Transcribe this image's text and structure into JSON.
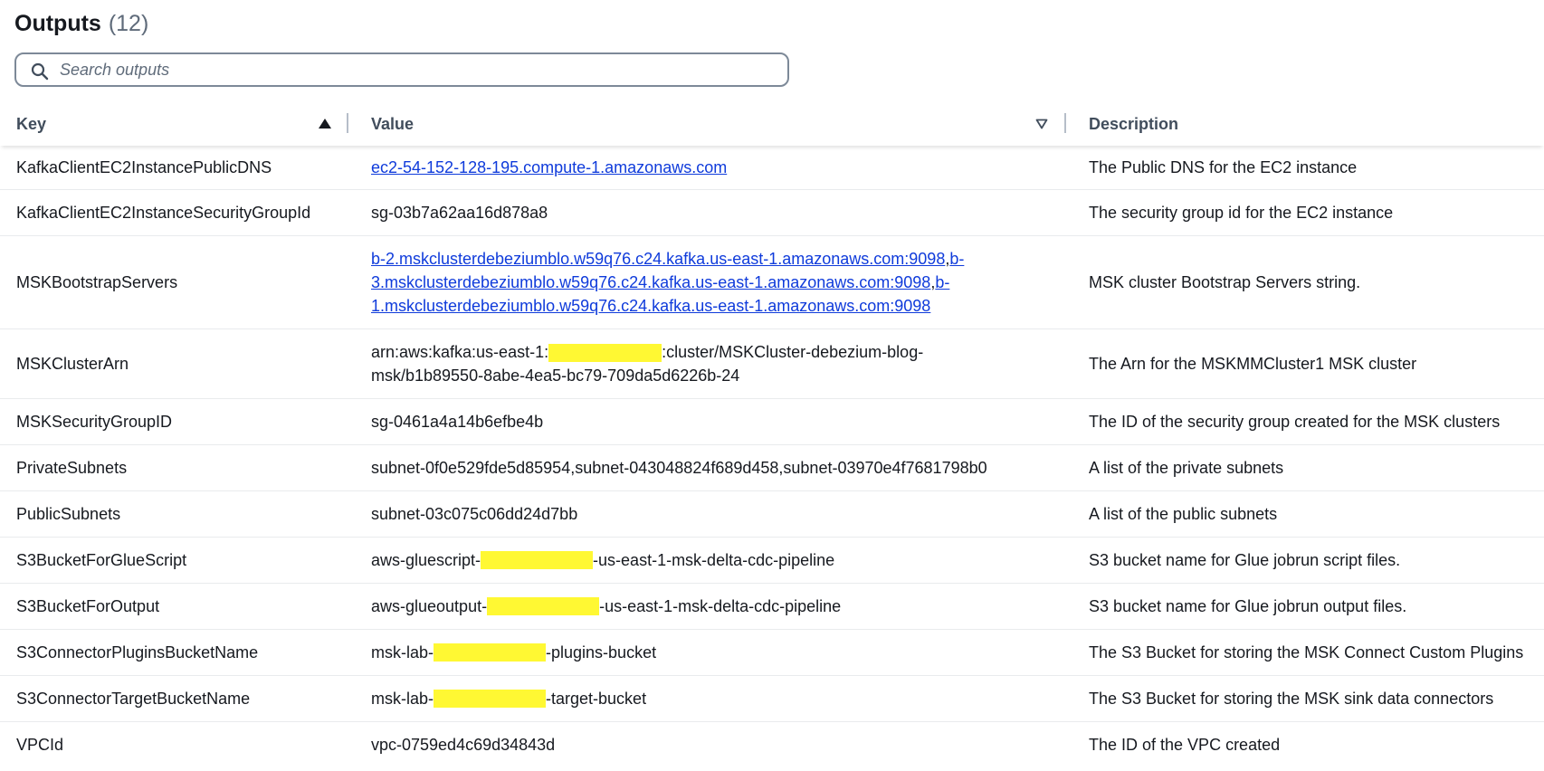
{
  "header": {
    "title": "Outputs",
    "count": "(12)"
  },
  "search": {
    "placeholder": "Search outputs"
  },
  "columns": {
    "key": "Key",
    "value": "Value",
    "description": "Description"
  },
  "rows": [
    {
      "key": "KafkaClientEC2InstancePublicDNS",
      "value": "ec2-54-152-128-195.compute-1.amazonaws.com",
      "description": "The Public DNS for the EC2 instance"
    },
    {
      "key": "KafkaClientEC2InstanceSecurityGroupId",
      "value": "sg-03b7a62aa16d878a8",
      "description": "The security group id for the EC2 instance"
    },
    {
      "key": "MSKBootstrapServers",
      "value_line1": "b-2.mskclusterdebeziumblo.w59q76.c24.kafka.us-east-1.amazonaws.com:9098",
      "value_line1b": "b-",
      "value_line2": "3.mskclusterdebeziumblo.w59q76.c24.kafka.us-east-1.amazonaws.com:9098",
      "value_line2b": "b-",
      "value_line3": "1.mskclusterdebeziumblo.w59q76.c24.kafka.us-east-1.amazonaws.com:9098",
      "sep": ",",
      "description": "MSK cluster Bootstrap Servers string."
    },
    {
      "key": "MSKClusterArn",
      "value_pre": "arn:aws:kafka:us-east-1:",
      "value_post": ":cluster/MSKCluster-debezium-blog-",
      "value_line2": "msk/b1b89550-8abe-4ea5-bc79-709da5d6226b-24",
      "description": "The Arn for the MSKMMCluster1 MSK cluster"
    },
    {
      "key": "MSKSecurityGroupID",
      "value": "sg-0461a4a14b6efbe4b",
      "description": "The ID of the security group created for the MSK clusters"
    },
    {
      "key": "PrivateSubnets",
      "value": "subnet-0f0e529fde5d85954,subnet-043048824f689d458,subnet-03970e4f7681798b0",
      "description": "A list of the private subnets"
    },
    {
      "key": "PublicSubnets",
      "value": "subnet-03c075c06dd24d7bb",
      "description": "A list of the public subnets"
    },
    {
      "key": "S3BucketForGlueScript",
      "value_pre": "aws-gluescript-",
      "value_post": "-us-east-1-msk-delta-cdc-pipeline",
      "description": "S3 bucket name for Glue jobrun script files."
    },
    {
      "key": "S3BucketForOutput",
      "value_pre": "aws-glueoutput-",
      "value_post": "-us-east-1-msk-delta-cdc-pipeline",
      "description": "S3 bucket name for Glue jobrun output files."
    },
    {
      "key": "S3ConnectorPluginsBucketName",
      "value_pre": "msk-lab-",
      "value_post": "-plugins-bucket",
      "description": "The S3 Bucket for storing the MSK Connect Custom Plugins"
    },
    {
      "key": "S3ConnectorTargetBucketName",
      "value_pre": "msk-lab-",
      "value_post": "-target-bucket",
      "description": "The S3 Bucket for storing the MSK sink data connectors"
    },
    {
      "key": "VPCId",
      "value": "vpc-0759ed4c69d34843d",
      "description": "The ID of the VPC created"
    }
  ],
  "colors": {
    "link": "#0f3bdb",
    "redaction": "#fff833",
    "text": "#16191f",
    "header_text": "#414d5c"
  },
  "icons": {
    "search": "search-icon",
    "sort_ascending": "sort-ascending-icon",
    "sort_none": "sort-descending-outline-icon"
  }
}
